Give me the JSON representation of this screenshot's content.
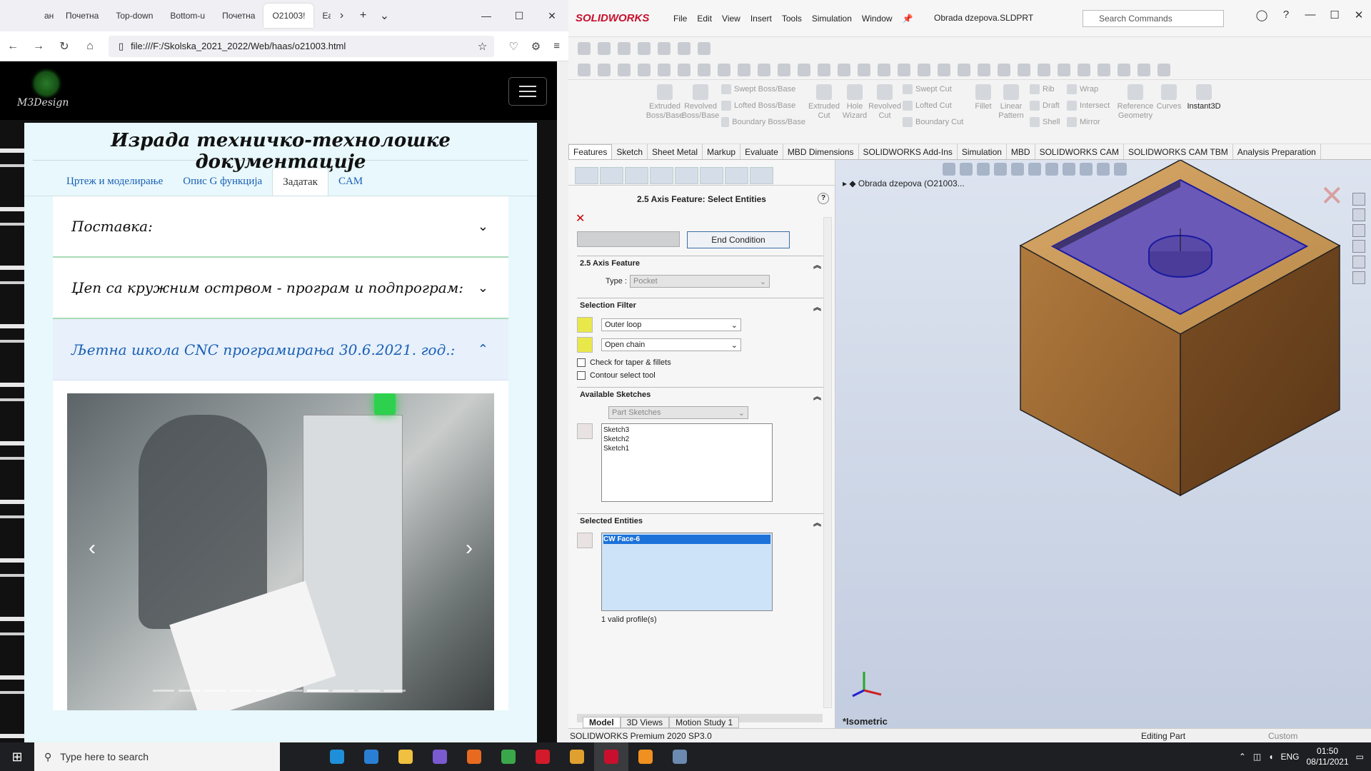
{
  "browser": {
    "tabs": [
      {
        "label": "‹ "
      },
      {
        "label": "ан"
      },
      {
        "label": "Почетна"
      },
      {
        "label": "Top-down"
      },
      {
        "label": "Bottom-u"
      },
      {
        "label": "Почетна"
      },
      {
        "label": "O21003!"
      },
      {
        "label": "Ea"
      }
    ],
    "url": "file:///F:/Skolska_2021_2022/Web/haas/o21003.html"
  },
  "website": {
    "logo_text": "M3Design",
    "title": "Израда техничко-технолошке документације",
    "tabs": [
      {
        "label": "Цртеж и моделирање"
      },
      {
        "label": "Опис G функција"
      },
      {
        "label": "Задатак"
      },
      {
        "label": "CAM"
      }
    ],
    "accordion": [
      {
        "label": "Поставка:"
      },
      {
        "label": "Џеп са кружним острвом - програм и подпрограм:"
      },
      {
        "label": "Љетна школа CNC програмирања 30.6.2021. год.:"
      }
    ]
  },
  "solidworks": {
    "brand": "SOLIDWORKS",
    "menu": [
      "File",
      "Edit",
      "View",
      "Insert",
      "Tools",
      "Simulation",
      "Window"
    ],
    "document": "Obrada dzepova.SLDPRT",
    "search_placeholder": "Search Commands",
    "ribbon": {
      "extruded_boss": "Extruded Boss/Base",
      "revolved_boss": "Revolved Boss/Base",
      "swept_boss": "Swept Boss/Base",
      "lofted_boss": "Lofted Boss/Base",
      "boundary_boss": "Boundary Boss/Base",
      "extruded_cut": "Extruded Cut",
      "hole_wizard": "Hole Wizard",
      "revolved_cut": "Revolved Cut",
      "swept_cut": "Swept Cut",
      "lofted_cut": "Lofted Cut",
      "boundary_cut": "Boundary Cut",
      "fillet": "Fillet",
      "linear_pattern": "Linear Pattern",
      "rib": "Rib",
      "draft": "Draft",
      "shell": "Shell",
      "wrap": "Wrap",
      "intersect": "Intersect",
      "mirror": "Mirror",
      "reference_geometry": "Reference Geometry",
      "curves": "Curves",
      "instant3d": "Instant3D"
    },
    "command_tabs": [
      "Features",
      "Sketch",
      "Sheet Metal",
      "Markup",
      "Evaluate",
      "MBD Dimensions",
      "SOLIDWORKS Add-Ins",
      "Simulation",
      "MBD",
      "SOLIDWORKS CAM",
      "SOLIDWORKS CAM TBM",
      "Analysis Preparation"
    ],
    "panel": {
      "title": "2.5 Axis Feature: Select Entities",
      "end_condition": "End Condition",
      "feature_header": "2.5 Axis Feature",
      "type_label": "Type :",
      "type_value": "Pocket",
      "selection_filter": "Selection Filter",
      "filter1": "Outer loop",
      "filter2": "Open chain",
      "check_taper": "Check for taper & fillets",
      "contour_tool": "Contour select tool",
      "available_sketches": "Available Sketches",
      "sketch_source": "Part Sketches",
      "sketches": [
        "Sketch3",
        "Sketch2",
        "Sketch1"
      ],
      "selected_entities": "Selected Entities",
      "selected": "CW Face-6",
      "valid_profiles": "1 valid profile(s)"
    },
    "tree_item": "Obrada dzepova  (O21003...",
    "view_label": "*Isometric",
    "bottom_tabs": [
      "Model",
      "3D Views",
      "Motion Study 1"
    ],
    "status": {
      "version": "SOLIDWORKS Premium 2020 SP3.0",
      "editing": "Editing Part",
      "units": "Custom"
    }
  },
  "taskbar": {
    "search_placeholder": "Type here to search",
    "language": "ENG",
    "time": "01:50",
    "date": "08/11/2021"
  }
}
